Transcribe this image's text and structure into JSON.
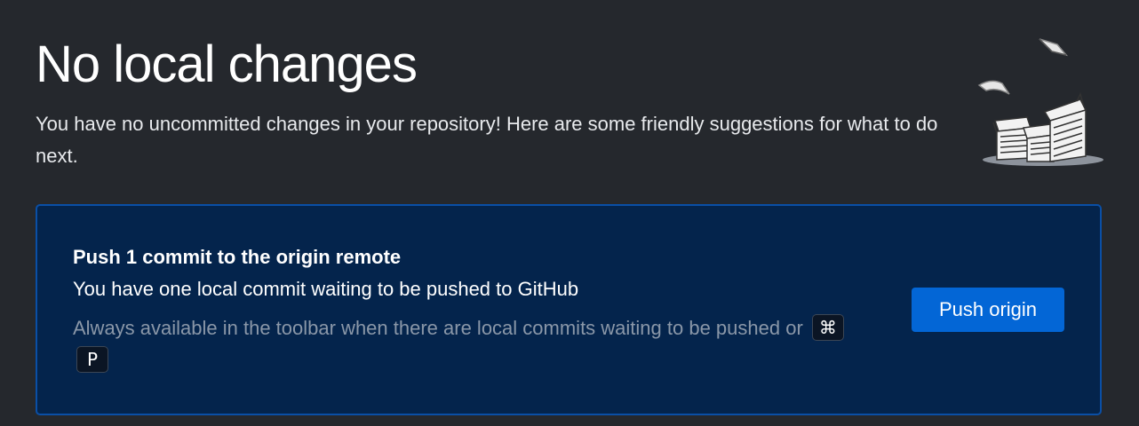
{
  "header": {
    "title": "No local changes",
    "subtitle": "You have no uncommitted changes in your repository! Here are some friendly suggestions for what to do next."
  },
  "illustration": {
    "icon": "paper-stacks-illustration"
  },
  "push_card": {
    "title": "Push 1 commit to the origin remote",
    "description": "You have one local commit waiting to be pushed to GitHub",
    "hint": "Always available in the toolbar when there are local commits waiting to be pushed or",
    "shortcut_keys": [
      "⌘",
      "P"
    ],
    "button_label": "Push origin"
  },
  "colors": {
    "background": "#25282d",
    "card_background": "#04244c",
    "card_border": "#0a4fa6",
    "button_background": "#0366d6",
    "hint_text": "#8a97a8"
  }
}
